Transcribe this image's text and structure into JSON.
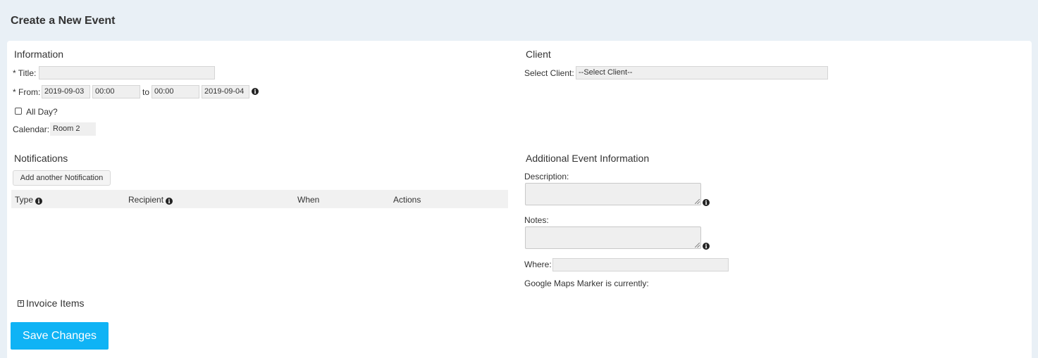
{
  "header": {
    "title": "Create a New Event"
  },
  "information": {
    "section_title": "Information",
    "title_label": "* Title:",
    "title_value": "",
    "from_label": "* From:",
    "from_date": "2019-09-03",
    "from_time": "00:00",
    "to_label": "to",
    "to_time": "00:00",
    "to_date": "2019-09-04",
    "all_day_label": "All Day?",
    "calendar_label": "Calendar:",
    "calendar_value": "Room 2"
  },
  "client": {
    "section_title": "Client",
    "select_label": "Select Client:",
    "select_value": "--Select Client--"
  },
  "notifications": {
    "section_title": "Notifications",
    "add_button": "Add another Notification",
    "columns": [
      "Type",
      "Recipient",
      "When",
      "Actions"
    ]
  },
  "additional": {
    "section_title": "Additional Event Information",
    "description_label": "Description:",
    "notes_label": "Notes:",
    "where_label": "Where:",
    "where_value": "",
    "maps_label": "Google Maps Marker is currently:"
  },
  "invoice": {
    "label": "Invoice Items",
    "toggle_symbol": "+"
  },
  "actions": {
    "save_label": "Save Changes"
  },
  "icons": {
    "info": "i"
  }
}
